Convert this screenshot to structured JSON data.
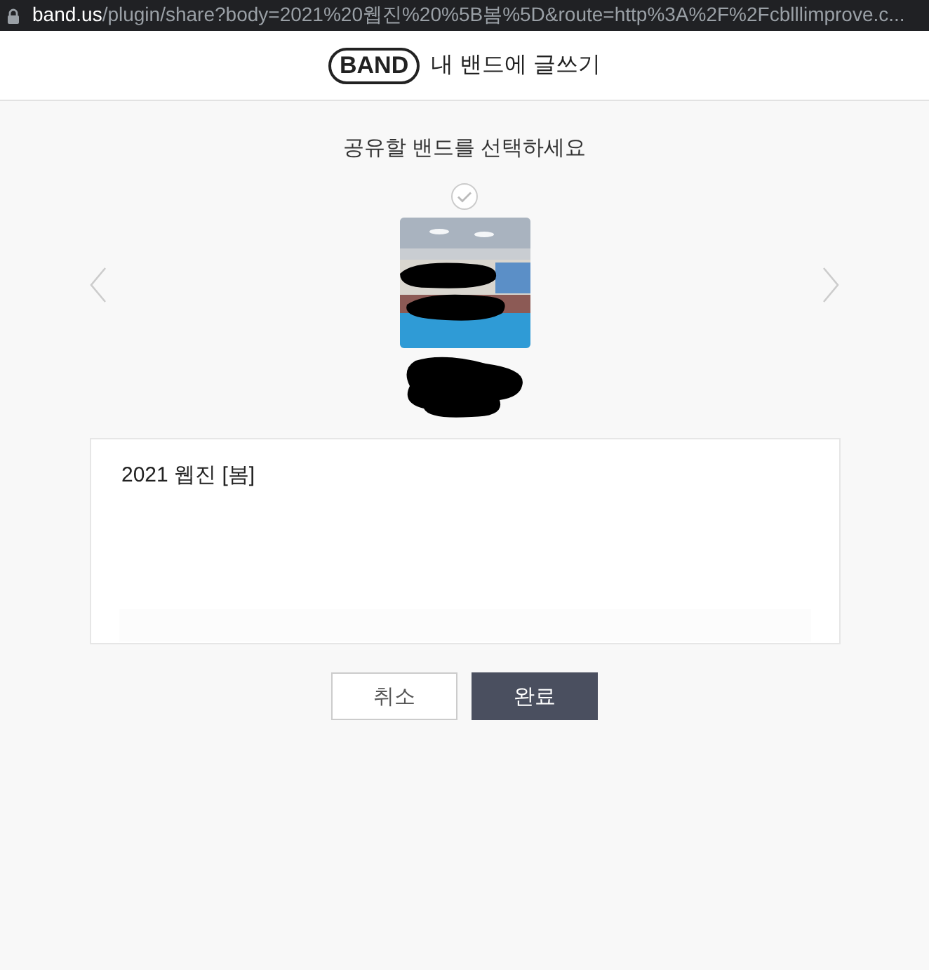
{
  "address_bar": {
    "domain": "band.us",
    "path": "/plugin/share?body=2021%20웹진%20%5B봄%5D&route=http%3A%2F%2Fcblllimprove.c..."
  },
  "header": {
    "logo": "BAND",
    "title": "내 밴드에 글쓰기"
  },
  "prompt": "공유할 밴드를 선택하세요",
  "message": {
    "value": "2021 웹진 [봄]"
  },
  "buttons": [
    {
      "label": "취소",
      "kind": "secondary"
    },
    {
      "label": "완료",
      "kind": "primary"
    }
  ]
}
